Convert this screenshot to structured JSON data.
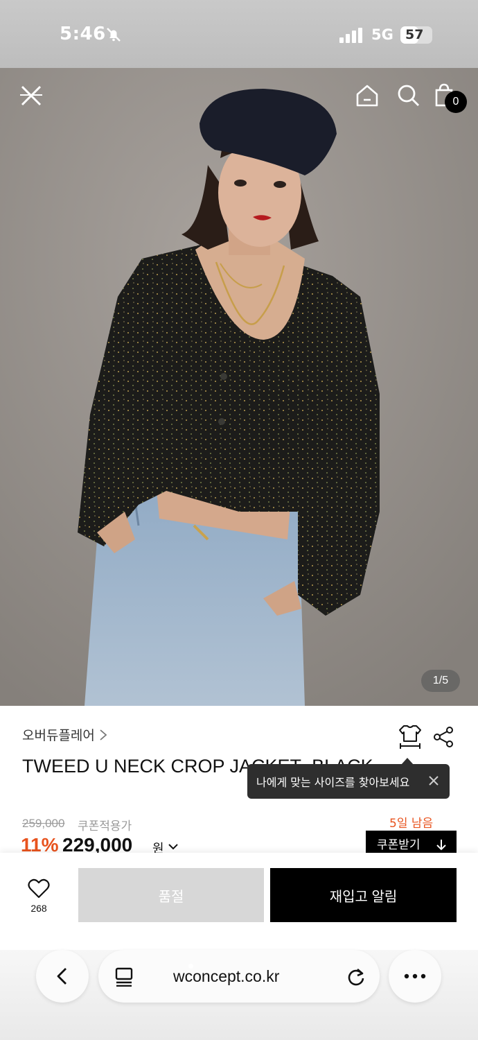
{
  "status_bar": {
    "time": "5:46",
    "network": "5G",
    "battery": "57",
    "battery_level": 0.57
  },
  "hero": {
    "image_counter": "1/5",
    "cart_count": "0"
  },
  "product": {
    "brand": "오버듀플레어",
    "title": "TWEED U NECK CROP JACKET_BLACK",
    "size_tooltip": "나에게 맞는 사이즈를 찾아보세요",
    "original_price": "259,000",
    "coupon_label": "쿠폰적용가",
    "days_left": "5일 남음",
    "discount": "11%",
    "price": "229,000",
    "price_unit": "원",
    "coupon_button": "쿠폰받기"
  },
  "actions": {
    "like_count": "268",
    "soldout": "품절",
    "restock": "재입고 알림"
  },
  "browser": {
    "url": "wconcept.co.kr"
  },
  "icons": [
    "close-icon",
    "home-icon",
    "search-icon",
    "shopping-bag-icon",
    "size-guide-icon",
    "share-icon",
    "heart-icon",
    "back-icon",
    "tabs-icon",
    "refresh-icon",
    "more-icon"
  ],
  "colors": {
    "accent": "#e8531e",
    "primary": "#000000",
    "disabled": "#d7d7d7"
  }
}
